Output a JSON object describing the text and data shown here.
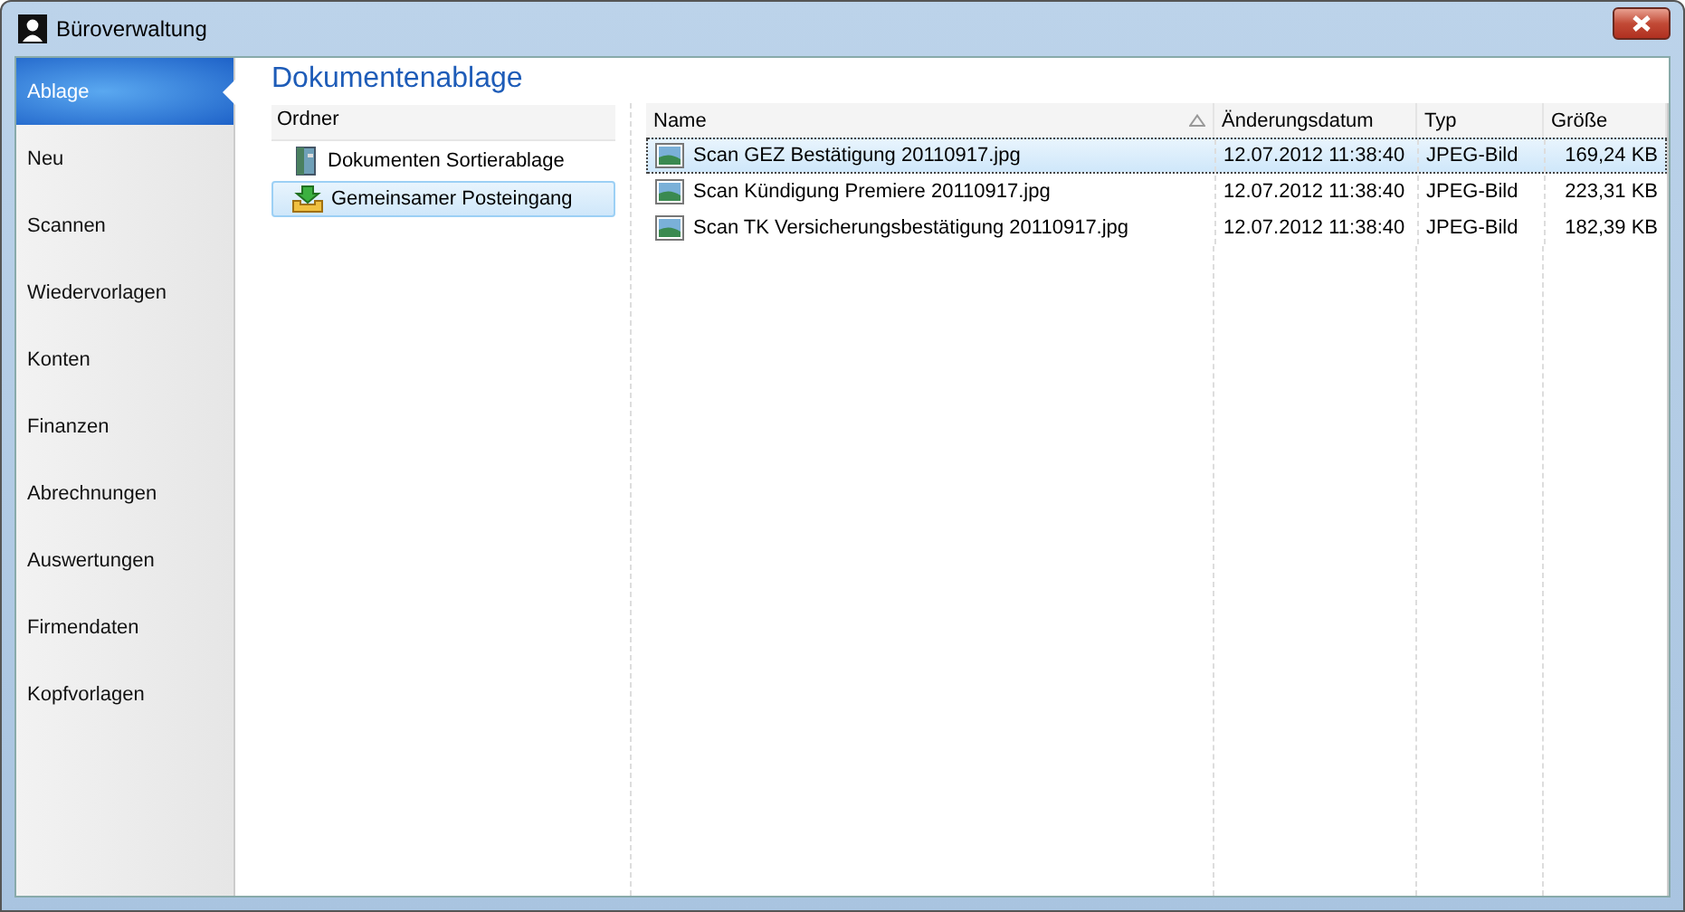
{
  "window": {
    "title": "Büroverwaltung"
  },
  "sidebar": {
    "items": [
      {
        "label": "Ablage",
        "selected": true
      },
      {
        "label": "Neu",
        "selected": false
      },
      {
        "label": "Scannen",
        "selected": false
      },
      {
        "label": "Wiedervorlagen",
        "selected": false
      },
      {
        "label": "Konten",
        "selected": false
      },
      {
        "label": "Finanzen",
        "selected": false
      },
      {
        "label": "Abrechnungen",
        "selected": false
      },
      {
        "label": "Auswertungen",
        "selected": false
      },
      {
        "label": "Firmendaten",
        "selected": false
      },
      {
        "label": "Kopfvorlagen",
        "selected": false
      }
    ]
  },
  "heading": "Dokumentenablage",
  "folders": {
    "header": "Ordner",
    "items": [
      {
        "label": "Dokumenten Sortierablage",
        "kind": "cabinet",
        "selected": false
      },
      {
        "label": "Gemeinsamer Posteingang",
        "kind": "inbox",
        "selected": true
      }
    ]
  },
  "table": {
    "columns": [
      "Name",
      "Änderungsdatum",
      "Typ",
      "Größe"
    ],
    "rows": [
      {
        "name": "Scan GEZ Bestätigung 20110917.jpg",
        "date": "12.07.2012 11:38:40",
        "type": "JPEG-Bild",
        "size": "169,24 KB",
        "selected": true
      },
      {
        "name": "Scan Kündigung Premiere 20110917.jpg",
        "date": "12.07.2012 11:38:40",
        "type": "JPEG-Bild",
        "size": "223,31 KB",
        "selected": false
      },
      {
        "name": "Scan TK Versicherungsbestätigung 20110917.jpg",
        "date": "12.07.2012 11:38:40",
        "type": "JPEG-Bild",
        "size": "182,39 KB",
        "selected": false
      }
    ]
  }
}
